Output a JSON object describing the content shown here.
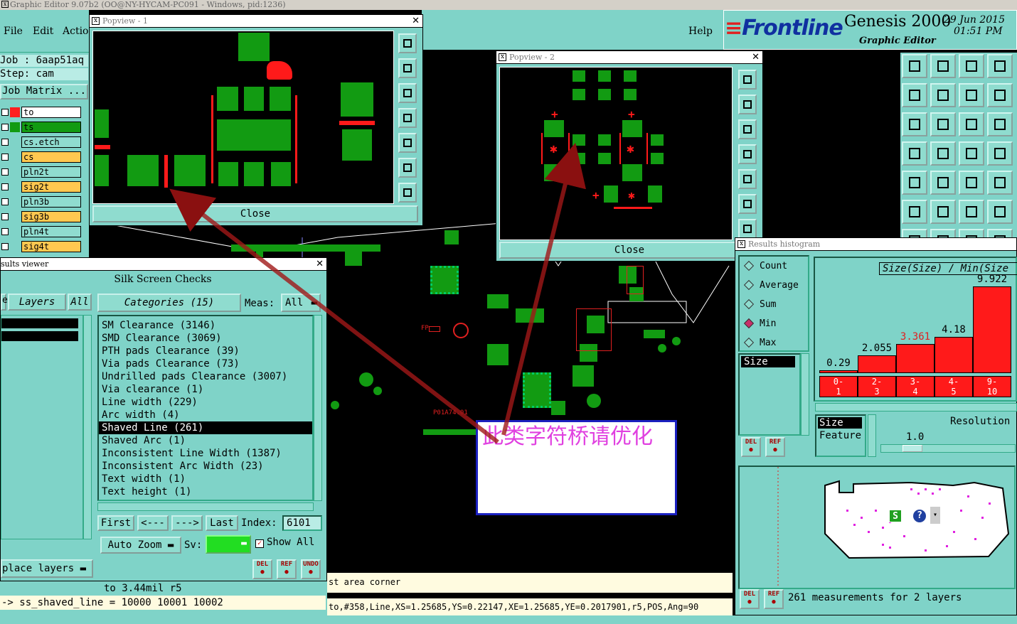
{
  "window": {
    "title": "Graphic Editor 9.07b2 (OO@NY-HYCAM-PC091 - Windows, pid:1236)"
  },
  "menu": {
    "file": "File",
    "edit": "Edit",
    "action": "Actio",
    "help": "Help"
  },
  "header": {
    "brand": "Frontline",
    "product": "Genesis 2000",
    "subtitle": "Graphic Editor",
    "date": "29 Jun 2015",
    "time": "01:51 PM"
  },
  "job": {
    "job_label": "Job : 6aap51aq",
    "step_label": "Step: cam",
    "matrix_label": "Job Matrix ..."
  },
  "layers": [
    {
      "name": "to",
      "color": "#ffffff",
      "swatch": "#ff2020"
    },
    {
      "name": "ts",
      "color": "#129b12",
      "swatch": "#129b12"
    },
    {
      "name": "cs.etch",
      "color": "#8fdccf",
      "swatch": ""
    },
    {
      "name": "cs",
      "color": "#ffc850",
      "swatch": ""
    },
    {
      "name": "pln2t",
      "color": "#8fdccf",
      "swatch": ""
    },
    {
      "name": "sig2t",
      "color": "#ffc850",
      "swatch": ""
    },
    {
      "name": "pln3b",
      "color": "#8fdccf",
      "swatch": ""
    },
    {
      "name": "sig3b",
      "color": "#ffc850",
      "swatch": ""
    },
    {
      "name": "pln4t",
      "color": "#8fdccf",
      "swatch": ""
    },
    {
      "name": "sig4t",
      "color": "#ffc850",
      "swatch": ""
    }
  ],
  "popview1": {
    "title": "Popview - 1",
    "close": "Close"
  },
  "popview2": {
    "title": "Popview - 2",
    "close": "Close"
  },
  "results": {
    "title": "sults viewer",
    "heading": "Silk Screen Checks",
    "tab_layers": "Layers",
    "tab_all": "All",
    "tab_e": "e",
    "categories_label": "Categories (15)",
    "meas_label": "Meas:",
    "meas_value": "All",
    "categories": [
      "SM Clearance (3146)",
      "SMD Clearance (3069)",
      "PTH pads Clearance (39)",
      "Via pads Clearance (73)",
      "Undrilled pads Clearance (3007)",
      "Via clearance (1)",
      "Line width (229)",
      "Arc width (4)",
      "Shaved Line (261)",
      "Shaved Arc (1)",
      "Inconsistent Line Width (1387)",
      "Inconsistent Arc Width (23)",
      "Text width (1)",
      "Text height (1)"
    ],
    "selected_index": 8,
    "nav": {
      "first": "First",
      "prev": "<---",
      "next": "--->",
      "last": "Last",
      "index_label": "Index:",
      "index_value": "6101"
    },
    "auto_zoom": "Auto Zoom",
    "sv_label": "Sv:",
    "show_all": "Show All",
    "place_layers": "place layers",
    "del": "DEL",
    "ref": "REF",
    "undo": "UNDO"
  },
  "status": {
    "line1": "to 3.44mil   r5",
    "line2": "-> ss_shaved_line = 10000 10001 10002",
    "hint": "st area corner",
    "feature": "to,#358,Line,XS=1.25685,YS=0.22147,XE=1.25685,YE=0.2017901,r5,POS,Ang=90"
  },
  "annotation": {
    "text": "此类字符桥请优化"
  },
  "pcb_labels": {
    "fp": "FP",
    "part": "P01A74.01"
  },
  "histogram": {
    "title": "Results histogram",
    "options": [
      "Count",
      "Average",
      "Sum",
      "Min",
      "Max"
    ],
    "selected_option": "Min",
    "chart_title": "Size(Size) / Min(Size",
    "list_header": "Size",
    "buckets": [
      {
        "range": "0-1",
        "value": 0.29,
        "label": "0.29"
      },
      {
        "range": "2-3",
        "value": 2.055,
        "label": "2.055"
      },
      {
        "range": "3-4",
        "value": 3.361,
        "label": "3.361"
      },
      {
        "range": "4-5",
        "value": 4.18,
        "label": "4.18"
      },
      {
        "range": "9-10",
        "value": 9.922,
        "label": "9.922"
      }
    ],
    "bucket_labels_top": [
      "0-",
      "2-",
      "3-",
      "4-",
      "9-"
    ],
    "bucket_labels_bot": [
      "1",
      "3",
      "4",
      "5",
      "10"
    ],
    "size_label": "Size",
    "feature_label": "Feature",
    "resolution_label": "Resolution",
    "resolution_value": "1.0",
    "summary": "261 measurements for 2 layers",
    "del": "DEL",
    "ref": "REF"
  },
  "chart_data": {
    "type": "bar",
    "title": "Size(Size) / Min(Size",
    "categories": [
      "0-1",
      "2-3",
      "3-4",
      "4-5",
      "9-10"
    ],
    "values": [
      0.29,
      2.055,
      3.361,
      4.18,
      9.922
    ],
    "xlabel": "",
    "ylabel": ""
  }
}
